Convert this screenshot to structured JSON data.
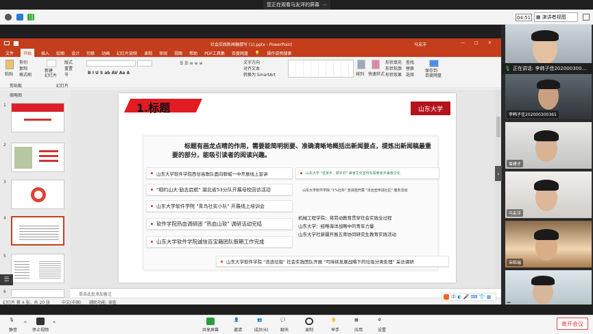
{
  "meeting": {
    "notice": "您正在观看马友洋的屏幕",
    "time": "04:51",
    "speaker_view": "演讲者视图",
    "speaking_now": "正在讲话: 李韩子佳202000300..."
  },
  "ppt": {
    "title": "社会实践新闻稿撰写 (1).pptx - PowerPoint",
    "user": "马友洋",
    "tabs": [
      "文件",
      "开始",
      "插入",
      "绘图",
      "设计",
      "切换",
      "动画",
      "幻灯片放映",
      "录制",
      "审阅",
      "视图",
      "帮助",
      "PDF工具集",
      "百度网盘"
    ],
    "search": "操作说明搜索",
    "ribbon": {
      "paste": "粘贴",
      "cut": "剪切",
      "copy": "复制",
      "format_painter": "格式刷",
      "new_slide": "新建\n幻灯片",
      "layout": "版式",
      "reset": "重置",
      "section": "节",
      "group_clipboard": "剪贴板",
      "group_slides": "幻灯片",
      "text_direction": "文字方向",
      "align_text": "对齐文本",
      "smartart": "转换为 SmartArt",
      "arrange": "排列",
      "quick_styles": "快速样式",
      "shape_fill": "形状填充",
      "shape_outline": "形状轮廓",
      "shape_effects": "形状效果",
      "find": "查找",
      "replace": "替换",
      "select": "选择",
      "save_baidu": "保存到\n百度网盘"
    },
    "thumbs_label": "缩略图",
    "slide_numbers": [
      "1",
      "2",
      "3",
      "4",
      "5",
      "6"
    ],
    "slide": {
      "title": "1.标题",
      "logo": "山东大学",
      "intro": "标题有画龙点睛的作用，需要能简明扼要、准确清晰地概括出新闻要点，提炼出新闻稿最重要的部分，能吸引读者的阅读兴趣。",
      "left_items": [
        "山东大学软件学院西甘高歌队面向聊城一中开展线上宣讲",
        "\"相约山大·励志启航\" 湖北省53分队开展母校回访活动",
        "山东大学软件学院 \"青鸟社实小队\" 开展线上培训会",
        "软件学院热血调研团 \"热血山软\" 调研活动完结",
        "山东大学软件学院诚信百宝箱团队假期工作完成"
      ],
      "right_top": "山东大学 \"返家乡、振乡村\" 美食文化宣传队探索家乡美食文化",
      "right_mid": "山东大学软件学院 \"1%社科\" 宣讲团开展 \"法治宣传进社区\" 服务活动",
      "right_list": [
        "机械工程学院：将劳动教育贯穿社会实践全过程",
        "山东大学：经略海洋战略中的青年力量",
        "山东大学社新疆开展五育协同研究生教育实践活动"
      ],
      "bottom": "山东大学软件学院 \"流浪垃圾\" 社会实践团队开展 \"可持续发展战略下的垃圾分类处理\" 采访调研"
    },
    "notes_placeholder": "单击此处添加备注",
    "status": {
      "slide_info": "幻灯片 第 4 张，共 20 张",
      "language": "中文(中国)",
      "accessibility": "辅助功能: 调查"
    }
  },
  "participants": [
    {
      "name": ""
    },
    {
      "name": "李韩子佳202000300365"
    },
    {
      "name": "曾建才"
    },
    {
      "name": "马友洋"
    },
    {
      "name": "宋皓瑞"
    },
    {
      "name": ""
    }
  ],
  "toolbar": {
    "mute": "静音",
    "stop_video": "停止视频",
    "share": "共享屏幕",
    "invite": "邀请",
    "members": "成员(6)",
    "chat": "聊天",
    "record": "录制",
    "raise_hand": "举手",
    "apps": "应用",
    "settings": "设置",
    "leave": "离开会议"
  },
  "colors": {
    "ppt_accent": "#c43e1c",
    "slide_title_bar": "#e31b23",
    "leave": "#e04040"
  }
}
